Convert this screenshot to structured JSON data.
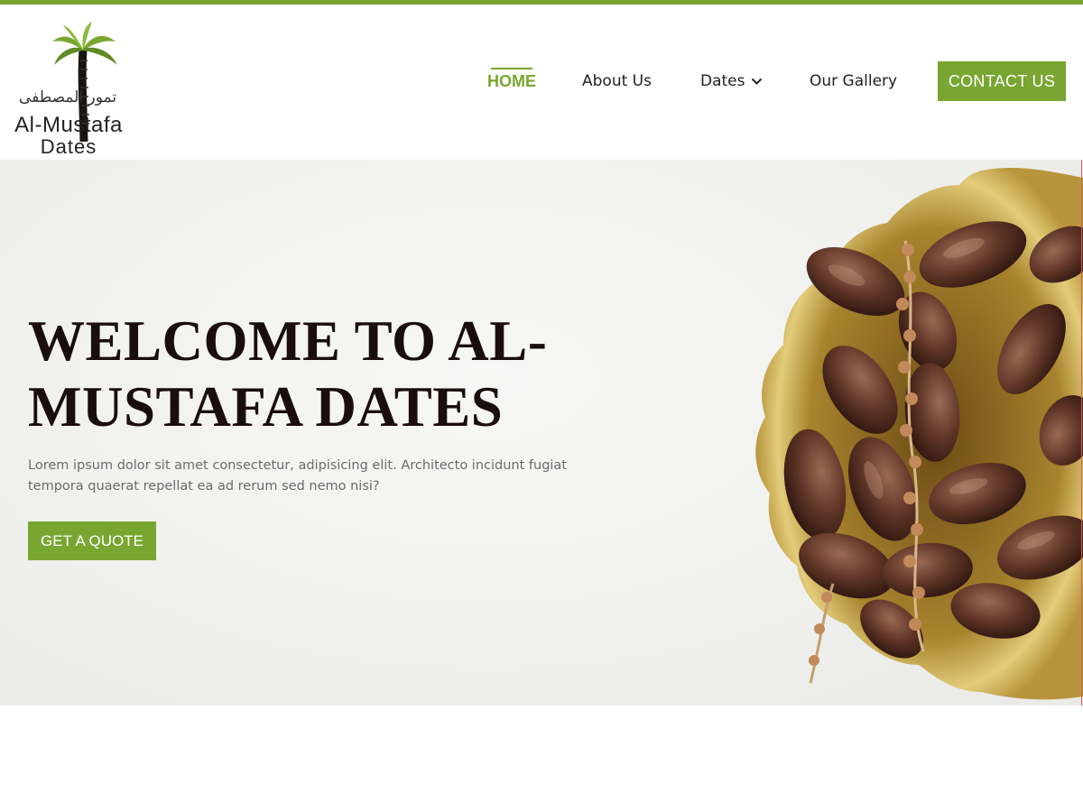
{
  "brand": {
    "arabic_name": "تمور المصطفى",
    "name": "Al-Mustafa",
    "sub": "Dates",
    "accent_color": "#79a631"
  },
  "nav": {
    "items": [
      {
        "label": "HOME",
        "active": true
      },
      {
        "label": "About Us"
      },
      {
        "label": "Dates",
        "icon": "chevron-down-icon"
      },
      {
        "label": "Our Gallery"
      }
    ],
    "contact_label": "CONTACT US"
  },
  "hero": {
    "title": "WELCOME TO AL-MUSTAFA DATES",
    "text": "Lorem ipsum dolor sit amet consectetur, adipisicing elit. Architecto incidunt fugiat tempora quaerat repellat ea ad rerum sed nemo nisi?",
    "cta_label": "GET A QUOTE",
    "image": "bowl-of-dates"
  }
}
